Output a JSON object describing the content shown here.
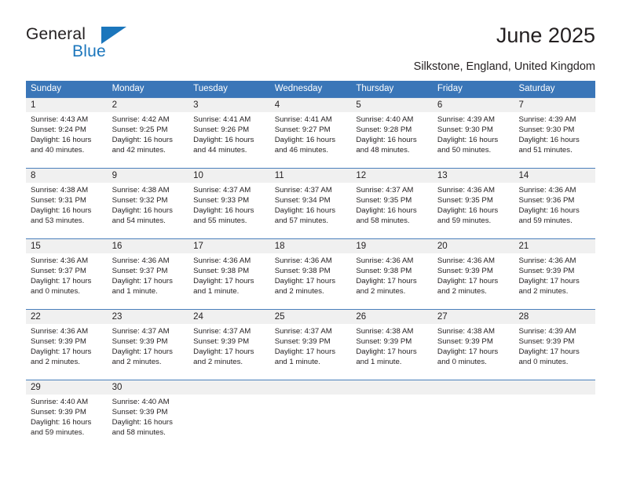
{
  "logo": {
    "word_primary": "General",
    "word_secondary": "Blue",
    "triangle_color": "#1b76bc"
  },
  "header": {
    "title": "June 2025",
    "subtitle": "Silkstone, England, United Kingdom"
  },
  "theme": {
    "header_bg": "#3a76b8",
    "daynum_bg": "#f0f0f0",
    "text": "#231f20",
    "accent": "#1b76bc"
  },
  "calendar": {
    "weekday_headers": [
      "Sunday",
      "Monday",
      "Tuesday",
      "Wednesday",
      "Thursday",
      "Friday",
      "Saturday"
    ],
    "weeks": [
      [
        {
          "day": "1",
          "sunrise": "Sunrise: 4:43 AM",
          "sunset": "Sunset: 9:24 PM",
          "daylight_line1": "Daylight: 16 hours",
          "daylight_line2": "and 40 minutes."
        },
        {
          "day": "2",
          "sunrise": "Sunrise: 4:42 AM",
          "sunset": "Sunset: 9:25 PM",
          "daylight_line1": "Daylight: 16 hours",
          "daylight_line2": "and 42 minutes."
        },
        {
          "day": "3",
          "sunrise": "Sunrise: 4:41 AM",
          "sunset": "Sunset: 9:26 PM",
          "daylight_line1": "Daylight: 16 hours",
          "daylight_line2": "and 44 minutes."
        },
        {
          "day": "4",
          "sunrise": "Sunrise: 4:41 AM",
          "sunset": "Sunset: 9:27 PM",
          "daylight_line1": "Daylight: 16 hours",
          "daylight_line2": "and 46 minutes."
        },
        {
          "day": "5",
          "sunrise": "Sunrise: 4:40 AM",
          "sunset": "Sunset: 9:28 PM",
          "daylight_line1": "Daylight: 16 hours",
          "daylight_line2": "and 48 minutes."
        },
        {
          "day": "6",
          "sunrise": "Sunrise: 4:39 AM",
          "sunset": "Sunset: 9:30 PM",
          "daylight_line1": "Daylight: 16 hours",
          "daylight_line2": "and 50 minutes."
        },
        {
          "day": "7",
          "sunrise": "Sunrise: 4:39 AM",
          "sunset": "Sunset: 9:30 PM",
          "daylight_line1": "Daylight: 16 hours",
          "daylight_line2": "and 51 minutes."
        }
      ],
      [
        {
          "day": "8",
          "sunrise": "Sunrise: 4:38 AM",
          "sunset": "Sunset: 9:31 PM",
          "daylight_line1": "Daylight: 16 hours",
          "daylight_line2": "and 53 minutes."
        },
        {
          "day": "9",
          "sunrise": "Sunrise: 4:38 AM",
          "sunset": "Sunset: 9:32 PM",
          "daylight_line1": "Daylight: 16 hours",
          "daylight_line2": "and 54 minutes."
        },
        {
          "day": "10",
          "sunrise": "Sunrise: 4:37 AM",
          "sunset": "Sunset: 9:33 PM",
          "daylight_line1": "Daylight: 16 hours",
          "daylight_line2": "and 55 minutes."
        },
        {
          "day": "11",
          "sunrise": "Sunrise: 4:37 AM",
          "sunset": "Sunset: 9:34 PM",
          "daylight_line1": "Daylight: 16 hours",
          "daylight_line2": "and 57 minutes."
        },
        {
          "day": "12",
          "sunrise": "Sunrise: 4:37 AM",
          "sunset": "Sunset: 9:35 PM",
          "daylight_line1": "Daylight: 16 hours",
          "daylight_line2": "and 58 minutes."
        },
        {
          "day": "13",
          "sunrise": "Sunrise: 4:36 AM",
          "sunset": "Sunset: 9:35 PM",
          "daylight_line1": "Daylight: 16 hours",
          "daylight_line2": "and 59 minutes."
        },
        {
          "day": "14",
          "sunrise": "Sunrise: 4:36 AM",
          "sunset": "Sunset: 9:36 PM",
          "daylight_line1": "Daylight: 16 hours",
          "daylight_line2": "and 59 minutes."
        }
      ],
      [
        {
          "day": "15",
          "sunrise": "Sunrise: 4:36 AM",
          "sunset": "Sunset: 9:37 PM",
          "daylight_line1": "Daylight: 17 hours",
          "daylight_line2": "and 0 minutes."
        },
        {
          "day": "16",
          "sunrise": "Sunrise: 4:36 AM",
          "sunset": "Sunset: 9:37 PM",
          "daylight_line1": "Daylight: 17 hours",
          "daylight_line2": "and 1 minute."
        },
        {
          "day": "17",
          "sunrise": "Sunrise: 4:36 AM",
          "sunset": "Sunset: 9:38 PM",
          "daylight_line1": "Daylight: 17 hours",
          "daylight_line2": "and 1 minute."
        },
        {
          "day": "18",
          "sunrise": "Sunrise: 4:36 AM",
          "sunset": "Sunset: 9:38 PM",
          "daylight_line1": "Daylight: 17 hours",
          "daylight_line2": "and 2 minutes."
        },
        {
          "day": "19",
          "sunrise": "Sunrise: 4:36 AM",
          "sunset": "Sunset: 9:38 PM",
          "daylight_line1": "Daylight: 17 hours",
          "daylight_line2": "and 2 minutes."
        },
        {
          "day": "20",
          "sunrise": "Sunrise: 4:36 AM",
          "sunset": "Sunset: 9:39 PM",
          "daylight_line1": "Daylight: 17 hours",
          "daylight_line2": "and 2 minutes."
        },
        {
          "day": "21",
          "sunrise": "Sunrise: 4:36 AM",
          "sunset": "Sunset: 9:39 PM",
          "daylight_line1": "Daylight: 17 hours",
          "daylight_line2": "and 2 minutes."
        }
      ],
      [
        {
          "day": "22",
          "sunrise": "Sunrise: 4:36 AM",
          "sunset": "Sunset: 9:39 PM",
          "daylight_line1": "Daylight: 17 hours",
          "daylight_line2": "and 2 minutes."
        },
        {
          "day": "23",
          "sunrise": "Sunrise: 4:37 AM",
          "sunset": "Sunset: 9:39 PM",
          "daylight_line1": "Daylight: 17 hours",
          "daylight_line2": "and 2 minutes."
        },
        {
          "day": "24",
          "sunrise": "Sunrise: 4:37 AM",
          "sunset": "Sunset: 9:39 PM",
          "daylight_line1": "Daylight: 17 hours",
          "daylight_line2": "and 2 minutes."
        },
        {
          "day": "25",
          "sunrise": "Sunrise: 4:37 AM",
          "sunset": "Sunset: 9:39 PM",
          "daylight_line1": "Daylight: 17 hours",
          "daylight_line2": "and 1 minute."
        },
        {
          "day": "26",
          "sunrise": "Sunrise: 4:38 AM",
          "sunset": "Sunset: 9:39 PM",
          "daylight_line1": "Daylight: 17 hours",
          "daylight_line2": "and 1 minute."
        },
        {
          "day": "27",
          "sunrise": "Sunrise: 4:38 AM",
          "sunset": "Sunset: 9:39 PM",
          "daylight_line1": "Daylight: 17 hours",
          "daylight_line2": "and 0 minutes."
        },
        {
          "day": "28",
          "sunrise": "Sunrise: 4:39 AM",
          "sunset": "Sunset: 9:39 PM",
          "daylight_line1": "Daylight: 17 hours",
          "daylight_line2": "and 0 minutes."
        }
      ],
      [
        {
          "day": "29",
          "sunrise": "Sunrise: 4:40 AM",
          "sunset": "Sunset: 9:39 PM",
          "daylight_line1": "Daylight: 16 hours",
          "daylight_line2": "and 59 minutes."
        },
        {
          "day": "30",
          "sunrise": "Sunrise: 4:40 AM",
          "sunset": "Sunset: 9:39 PM",
          "daylight_line1": "Daylight: 16 hours",
          "daylight_line2": "and 58 minutes."
        },
        {
          "day": "",
          "sunrise": "",
          "sunset": "",
          "daylight_line1": "",
          "daylight_line2": ""
        },
        {
          "day": "",
          "sunrise": "",
          "sunset": "",
          "daylight_line1": "",
          "daylight_line2": ""
        },
        {
          "day": "",
          "sunrise": "",
          "sunset": "",
          "daylight_line1": "",
          "daylight_line2": ""
        },
        {
          "day": "",
          "sunrise": "",
          "sunset": "",
          "daylight_line1": "",
          "daylight_line2": ""
        },
        {
          "day": "",
          "sunrise": "",
          "sunset": "",
          "daylight_line1": "",
          "daylight_line2": ""
        }
      ]
    ]
  }
}
